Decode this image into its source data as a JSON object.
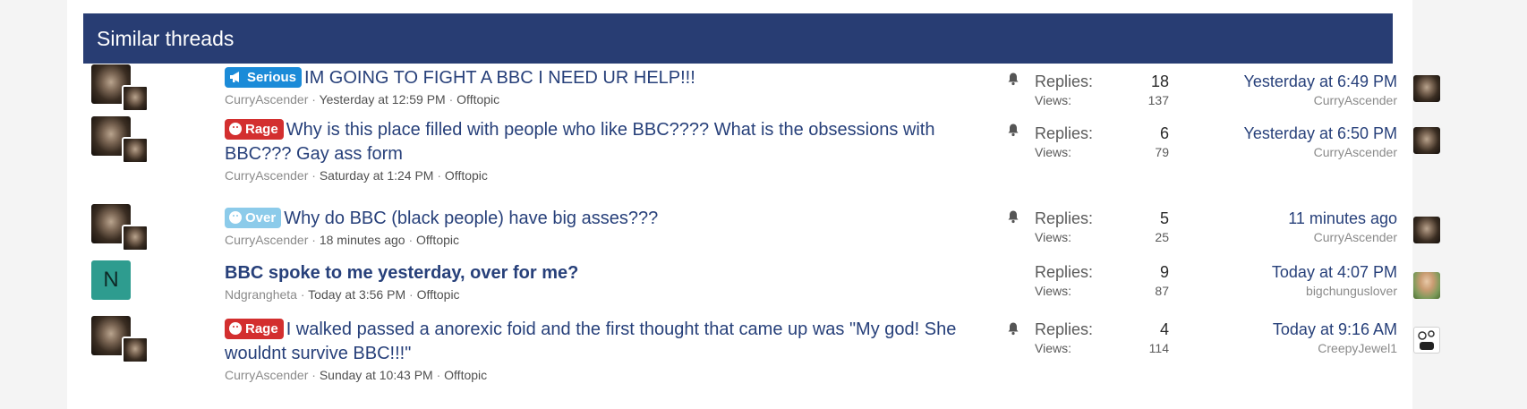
{
  "header": {
    "title": "Similar threads"
  },
  "colors": {
    "header_bg": "#283d73",
    "label_serious": "#1b8bd8",
    "label_rage": "#d32f2f",
    "label_over": "#8ccbea"
  },
  "threads": [
    {
      "prefix": "Serious",
      "prefix_icon": "megaphone-icon",
      "title": "IM GOING TO FIGHT A BBC I NEED UR HELP!!!",
      "author": "CurryAscender",
      "date": "Yesterday at 12:59 PM",
      "forum": "Offtopic",
      "replies_label": "Replies:",
      "replies": "18",
      "views_label": "Views:",
      "views": "137",
      "last_time": "Yesterday at 6:49 PM",
      "last_user": "CurryAscender"
    },
    {
      "prefix": "Rage",
      "prefix_icon": "angry-face-icon",
      "title": "Why is this place filled with people who like BBC???? What is the obsessions with BBC??? Gay ass form",
      "author": "CurryAscender",
      "date": "Saturday at 1:24 PM",
      "forum": "Offtopic",
      "replies_label": "Replies:",
      "replies": "6",
      "views_label": "Views:",
      "views": "79",
      "last_time": "Yesterday at 6:50 PM",
      "last_user": "CurryAscender"
    },
    {
      "prefix": "Over",
      "prefix_icon": "sad-face-icon",
      "title": "Why do BBC (black people) have big asses???",
      "author": "CurryAscender",
      "date": "18 minutes ago",
      "forum": "Offtopic",
      "replies_label": "Replies:",
      "replies": "5",
      "views_label": "Views:",
      "views": "25",
      "last_time": "11 minutes ago",
      "last_user": "CurryAscender"
    },
    {
      "prefix": "",
      "avatar_letter": "N",
      "title": "BBC spoke to me yesterday, over for me?",
      "author": "Ndgrangheta",
      "date": "Today at 3:56 PM",
      "forum": "Offtopic",
      "replies_label": "Replies:",
      "replies": "9",
      "views_label": "Views:",
      "views": "87",
      "last_time": "Today at 4:07 PM",
      "last_user": "bigchunguslover"
    },
    {
      "prefix": "Rage",
      "prefix_icon": "angry-face-icon",
      "title": "I walked passed a anorexic foid and the first thought that came up was \"My god! She wouldnt survive BBC!!!\"",
      "author": "CurryAscender",
      "date": "Sunday at 10:43 PM",
      "forum": "Offtopic",
      "replies_label": "Replies:",
      "replies": "4",
      "views_label": "Views:",
      "views": "114",
      "last_time": "Today at 9:16 AM",
      "last_user": "CreepyJewel1"
    }
  ],
  "separator": "·"
}
